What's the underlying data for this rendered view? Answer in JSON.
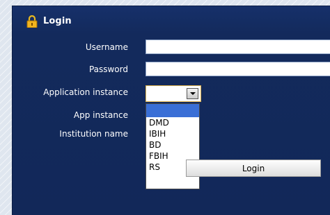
{
  "panel": {
    "title": "Login",
    "icon": "lock-icon"
  },
  "form": {
    "username_label": "Username",
    "username_value": "",
    "password_label": "Password",
    "password_value": "",
    "app_instance_label": "Application instance",
    "app_instance_value": "",
    "app_instance2_label": "App instance",
    "institution_label": "Institution name",
    "login_button_label": "Login"
  },
  "dropdown": {
    "options": [
      "",
      "DMD",
      "IBIH",
      "BD",
      "FBIH",
      "RS"
    ],
    "selected_index": 0
  },
  "colors": {
    "panel_background": "#132a5c",
    "focus_border": "#e0b24a",
    "selection_highlight": "#3a6fd6"
  }
}
